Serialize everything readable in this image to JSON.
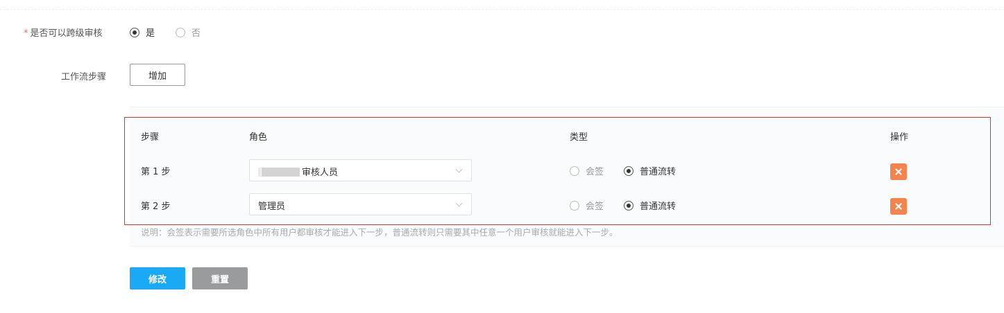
{
  "cross_level": {
    "required_mark": "*",
    "label": "是否可以跨级审核",
    "options": [
      {
        "label": "是",
        "checked": true
      },
      {
        "label": "否",
        "checked": false
      }
    ]
  },
  "workflow": {
    "label": "工作流步骤",
    "add_button": "增加",
    "headers": {
      "step": "步骤",
      "role": "角色",
      "type": "类型",
      "action": "操作"
    },
    "rows": [
      {
        "step": "第 1 步",
        "role": "审核人员",
        "role_partially_redacted": true,
        "type_options": [
          "会签",
          "普通流转"
        ],
        "selected_type": "普通流转"
      },
      {
        "step": "第 2 步",
        "role": "管理员",
        "role_partially_redacted": false,
        "type_options": [
          "会签",
          "普通流转"
        ],
        "selected_type": "普通流转"
      }
    ],
    "note": "说明：会签表示需要所选角色中所有用户都审核才能进入下一步，普通流转则只需要其中任意一个用户审核就能进入下一步。"
  },
  "buttons": {
    "submit": "修改",
    "reset": "重置"
  },
  "colors": {
    "primary": "#1aaaf5",
    "delete": "#f3844e",
    "reset": "#9a9b9d",
    "highlight_border": "#e0312b"
  },
  "icons": {
    "delete": "close-icon",
    "select_caret": "chevron-down-icon"
  }
}
